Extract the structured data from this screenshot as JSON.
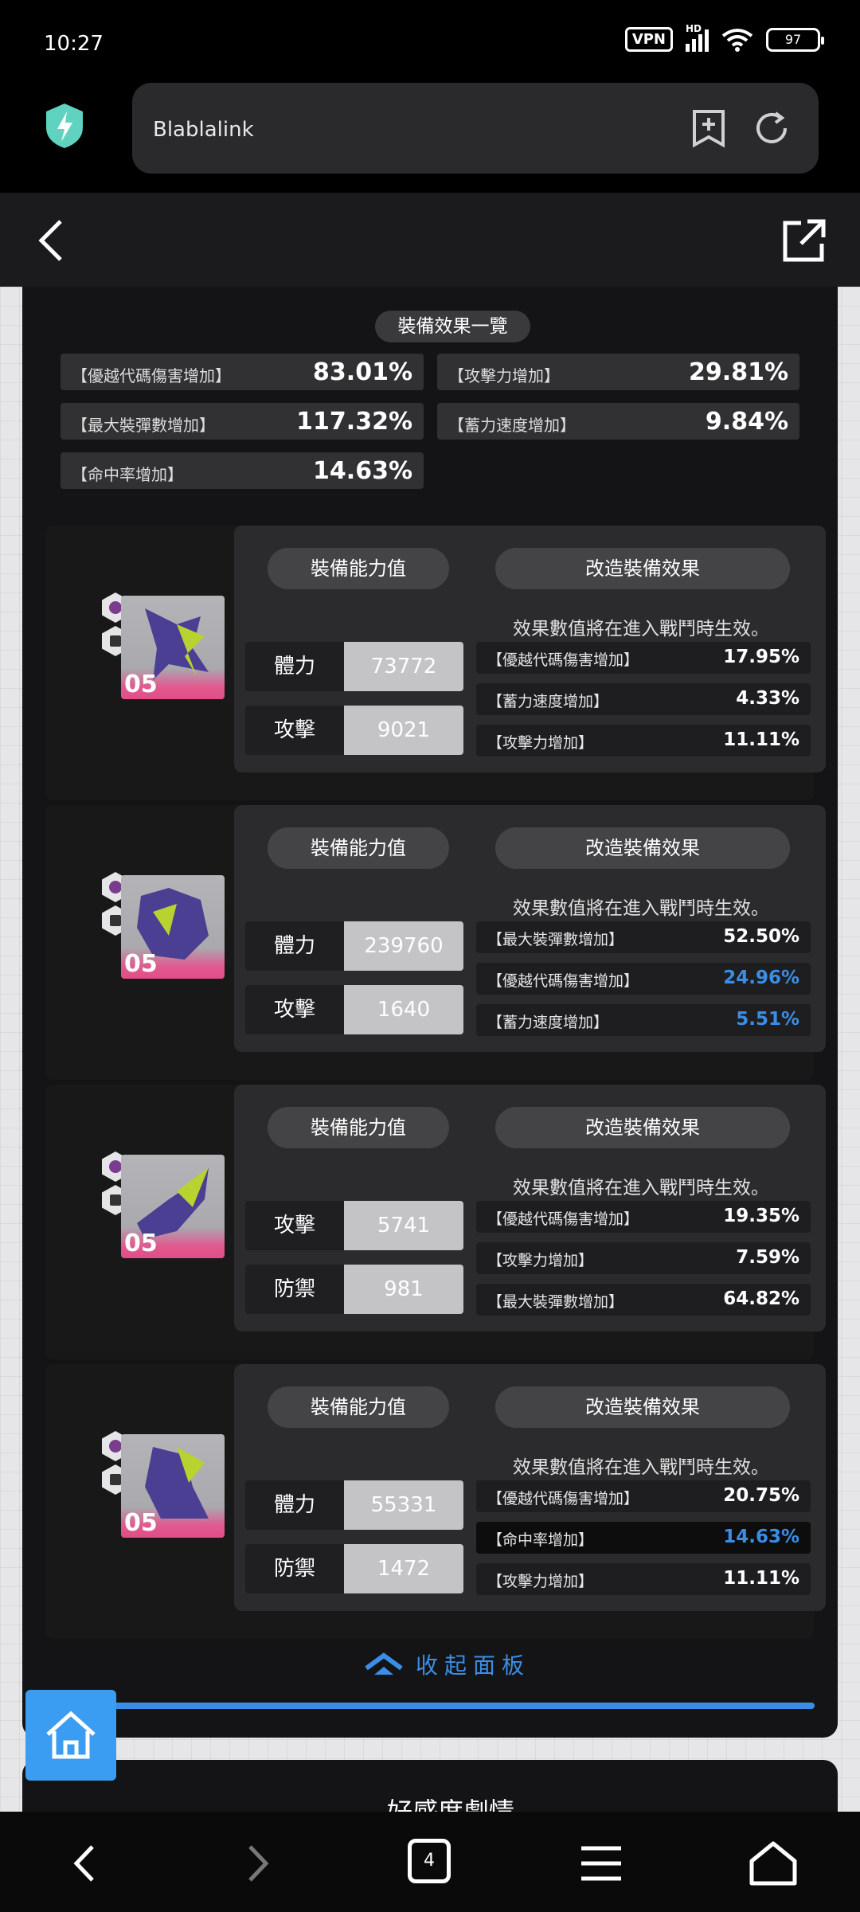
{
  "status": {
    "time": "10:27",
    "vpn": "VPN",
    "network": "HD",
    "battery": "97"
  },
  "browser": {
    "url": "Blablalink"
  },
  "summary": {
    "title": "裝備效果一覽",
    "items": [
      {
        "label": "【優越代碼傷害增加】",
        "value": "83.01%"
      },
      {
        "label": "【攻擊力增加】",
        "value": "29.81%"
      },
      {
        "label": "【最大裝彈數增加】",
        "value": "117.32%"
      },
      {
        "label": "【蓄力速度增加】",
        "value": "9.84%"
      },
      {
        "label": "【命中率增加】",
        "value": "14.63%"
      }
    ]
  },
  "equip_labels": {
    "stat_header": "裝備能力值",
    "effect_header": "改造裝備效果",
    "note": "效果數值將在進入戰鬥時生效。"
  },
  "equipment": [
    {
      "level": "05",
      "stats": [
        {
          "label": "體力",
          "value": "73772"
        },
        {
          "label": "攻擊",
          "value": "9021"
        }
      ],
      "effects": [
        {
          "label": "【優越代碼傷害增加】",
          "value": "17.95%"
        },
        {
          "label": "【蓄力速度增加】",
          "value": "4.33%"
        },
        {
          "label": "【攻擊力增加】",
          "value": "11.11%"
        }
      ]
    },
    {
      "level": "05",
      "stats": [
        {
          "label": "體力",
          "value": "239760"
        },
        {
          "label": "攻擊",
          "value": "1640"
        }
      ],
      "effects": [
        {
          "label": "【最大裝彈數增加】",
          "value": "52.50%"
        },
        {
          "label": "【優越代碼傷害增加】",
          "value": "24.96%"
        },
        {
          "label": "【蓄力速度增加】",
          "value": "5.51%"
        }
      ]
    },
    {
      "level": "05",
      "stats": [
        {
          "label": "攻擊",
          "value": "5741"
        },
        {
          "label": "防禦",
          "value": "981"
        }
      ],
      "effects": [
        {
          "label": "【優越代碼傷害增加】",
          "value": "19.35%"
        },
        {
          "label": "【攻擊力增加】",
          "value": "7.59%"
        },
        {
          "label": "【最大裝彈數增加】",
          "value": "64.82%"
        }
      ]
    },
    {
      "level": "05",
      "stats": [
        {
          "label": "體力",
          "value": "55331"
        },
        {
          "label": "防禦",
          "value": "1472"
        }
      ],
      "effects": [
        {
          "label": "【優越代碼傷害增加】",
          "value": "20.75%"
        },
        {
          "label": "【命中率增加】",
          "value": "14.63%"
        },
        {
          "label": "【攻擊力增加】",
          "value": "11.11%"
        }
      ]
    }
  ],
  "collapse_label": "收起面板",
  "next_section": "好感度劇情",
  "tabs_count": "4",
  "colors": {
    "accent": "#3a8ee6",
    "panel": "#141416",
    "card": "#2b2b2d"
  },
  "icons": [
    "shield-bolt-icon",
    "bookmark-add-icon",
    "refresh-icon",
    "back-arrow-icon",
    "external-link-icon",
    "home-icon",
    "chevron-up-icon"
  ]
}
